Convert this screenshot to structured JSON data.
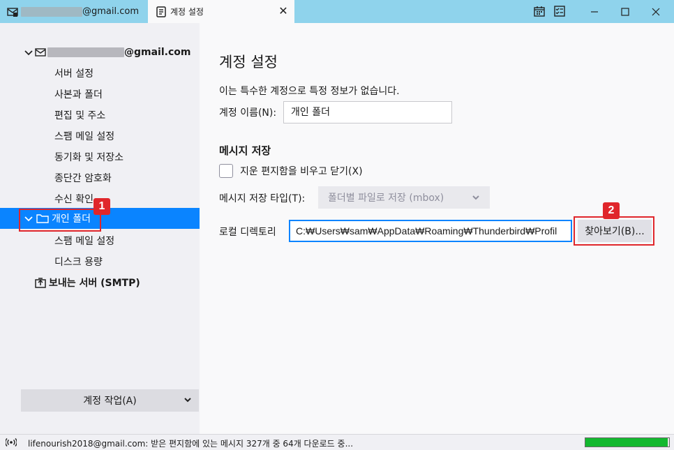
{
  "titlebar": {
    "mail_tab_suffix": "@gmail.com",
    "settings_tab_label": "계정 설정",
    "close_glyph": "✕"
  },
  "sidebar": {
    "account_suffix": "@gmail.com",
    "account_items": [
      "서버 설정",
      "사본과 폴더",
      "편집 및 주소",
      "스팸 메일 설정",
      "동기화 및 저장소",
      "종단간 암호화",
      "수신 확인"
    ],
    "personal_folder": "개인 폴더",
    "personal_items": [
      "스팸 메일 설정",
      "디스크 용량"
    ],
    "smtp": "보내는 서버 (SMTP)",
    "account_actions": "계정 작업(A)"
  },
  "main": {
    "title": "계정 설정",
    "description": "이는 특수한 계정으로 특정 정보가 없습니다.",
    "account_name_label": "계정 이름(N):",
    "account_name_value": "개인 폴더",
    "section_title": "메시지 저장",
    "empty_trash_label": "지운 편지함을 비우고 닫기(X)",
    "store_type_label": "메시지 저장 타입(T):",
    "store_type_value": "폴더별 파일로 저장 (mbox)",
    "local_dir_label": "로컬 디렉토리",
    "local_dir_value": "C:₩Users₩sam₩AppData₩Roaming₩Thunderbird₩Profil",
    "browse_label": "찾아보기(B)..."
  },
  "annotations": {
    "badge1": "1",
    "badge2": "2"
  },
  "status": {
    "text": "lifenourish2018@gmail.com: 받은 편지함에 있는 메시지 327개 중 64개 다운로드 중...",
    "progress_fraction": 0.98
  },
  "colors": {
    "titlebar": "#8fd3ec",
    "selection": "#0a84ff",
    "annotation": "#e0262b",
    "progress": "#13b82f"
  }
}
